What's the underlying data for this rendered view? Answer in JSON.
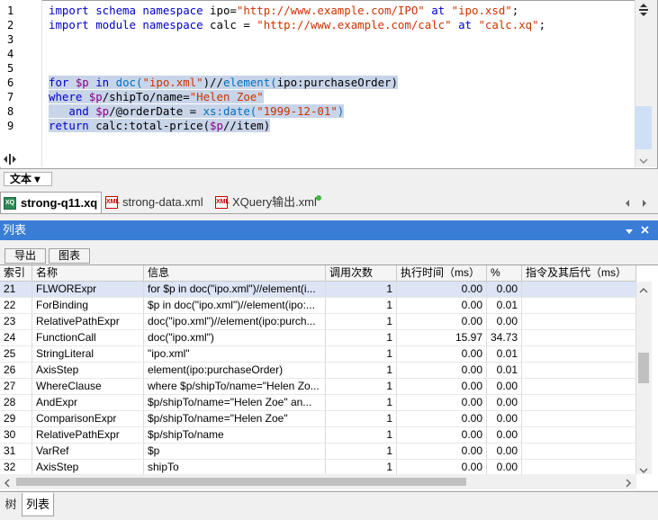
{
  "editor": {
    "line_numbers": [
      "1",
      "2",
      "3",
      "4",
      "5",
      "6",
      "7",
      "8",
      "9"
    ],
    "line1": {
      "kw1": "import schema namespace ",
      "p1": "ipo=",
      "s1": "\"http://www.example.com/IPO\"",
      "kw2": " at ",
      "s2": "\"ipo.xsd\"",
      "p2": ";"
    },
    "line2": {
      "kw1": "import module namespace ",
      "p1": "calc = ",
      "s1": "\"http://www.example.com/calc\"",
      "kw2": " at ",
      "s2": "\"calc.xq\"",
      "p2": ";"
    },
    "line6": {
      "a": "for ",
      "b": "$p",
      "c": " in ",
      "d": "doc(",
      "e": "\"ipo.xml\"",
      "f": ")//",
      "g": "element(",
      "h": "ipo:purchaseOrder",
      "i": ")"
    },
    "line7": {
      "a": "where ",
      "b": "$p",
      "c": "/shipTo/name=",
      "d": "\"Helen Zoe\""
    },
    "line8": {
      "a": "   and ",
      "b": "$p",
      "c": "/@orderDate = ",
      "d": "xs:date(",
      "e": "\"1999-12-01\"",
      "f": ")"
    },
    "line9": {
      "a": "return ",
      "b": "calc:total-price(",
      "c": "$p",
      "d": "//item)"
    },
    "view_button": "文本 ▾"
  },
  "tabs": [
    {
      "label": "strong-q11.xq",
      "icon": "XQ"
    },
    {
      "label": "strong-data.xml",
      "icon": "XML"
    },
    {
      "label": "XQuery输出.xml",
      "icon": "XML"
    }
  ],
  "list_panel": {
    "title": "列表",
    "buttons": [
      "导出",
      "图表"
    ],
    "columns": [
      "索引",
      "名称",
      "信息",
      "调用次数",
      "执行时间（ms）",
      "%",
      "指令及其后代（ms）"
    ],
    "rows": [
      [
        "21",
        "FLWORExpr",
        "for $p in doc(\"ipo.xml\")//element(i...",
        "1",
        "0.00",
        "0.00"
      ],
      [
        "22",
        "ForBinding",
        "$p in doc(\"ipo.xml\")//element(ipo:...",
        "1",
        "0.00",
        "0.01"
      ],
      [
        "23",
        "RelativePathExpr",
        "doc(\"ipo.xml\")//element(ipo:purch...",
        "1",
        "0.00",
        "0.00"
      ],
      [
        "24",
        "FunctionCall",
        "doc(\"ipo.xml\")",
        "1",
        "15.97",
        "34.73"
      ],
      [
        "25",
        "StringLiteral",
        "\"ipo.xml\"",
        "1",
        "0.00",
        "0.01"
      ],
      [
        "26",
        "AxisStep",
        "element(ipo:purchaseOrder)",
        "1",
        "0.00",
        "0.01"
      ],
      [
        "27",
        "WhereClause",
        "where $p/shipTo/name=\"Helen Zo...",
        "1",
        "0.00",
        "0.00"
      ],
      [
        "28",
        "AndExpr",
        "$p/shipTo/name=\"Helen Zoe\"   an...",
        "1",
        "0.00",
        "0.00"
      ],
      [
        "29",
        "ComparisonExpr",
        "$p/shipTo/name=\"Helen Zoe\"",
        "1",
        "0.00",
        "0.00"
      ],
      [
        "30",
        "RelativePathExpr",
        "$p/shipTo/name",
        "1",
        "0.00",
        "0.00"
      ],
      [
        "31",
        "VarRef",
        "$p",
        "1",
        "0.00",
        "0.00"
      ],
      [
        "32",
        "AxisStep",
        "shipTo",
        "1",
        "0.00",
        "0.00"
      ]
    ]
  },
  "bottom_tabs": [
    "树",
    "列表"
  ],
  "colors": {
    "keyword": "#0000cc",
    "string": "#cc3300",
    "variable": "#8b008b",
    "function": "#0070c0",
    "selection": "#c8d4e8",
    "panel_header": "#3a7dd6",
    "selected_row": "#dde4f6"
  }
}
